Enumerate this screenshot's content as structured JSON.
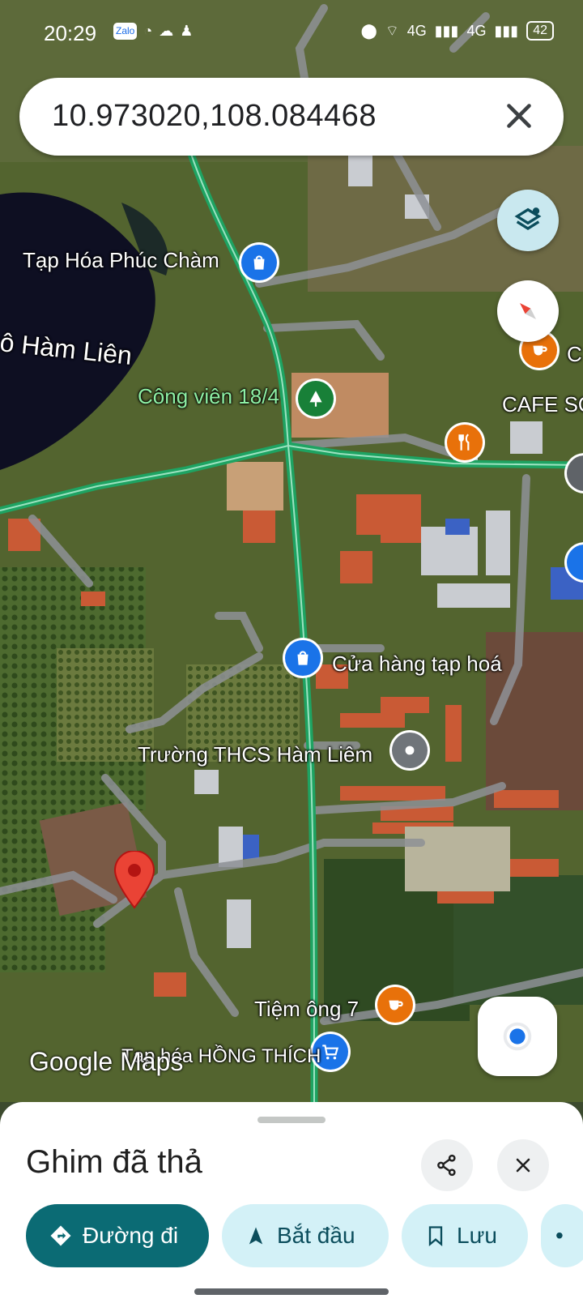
{
  "status_bar": {
    "time": "20:29",
    "app_icons": [
      "Zalo",
      "messenger-icon",
      "cloud-icon",
      "person-icon"
    ],
    "battery": "42",
    "network_labels": [
      "4G",
      "4G"
    ]
  },
  "search": {
    "query": "10.973020,108.084468"
  },
  "map": {
    "labels": {
      "store1": "Tạp Hóa Phúc Chàm",
      "lake": "ô Hàm Liên",
      "park": "Công viên 18/4",
      "cafe_c": "C",
      "cafe_so": "CAFE SO",
      "store2": "Cửa hàng tạp hoá",
      "school": "Trường THCS Hàm Liêm",
      "cafe7": "Tiệm ông 7",
      "store3": "Tạp hóa HỒNG THÍCH"
    },
    "watermark": "Google Maps",
    "colors": {
      "shop_pin": "#1a73e8",
      "park_pin": "#188038",
      "food_pin": "#e8710a",
      "dropped_pin": "#ea4335",
      "route": "#1ea362"
    }
  },
  "sheet": {
    "title": "Ghim đã thả",
    "actions": {
      "directions": "Đường đi",
      "start": "Bắt đầu",
      "save": "Lưu"
    }
  }
}
